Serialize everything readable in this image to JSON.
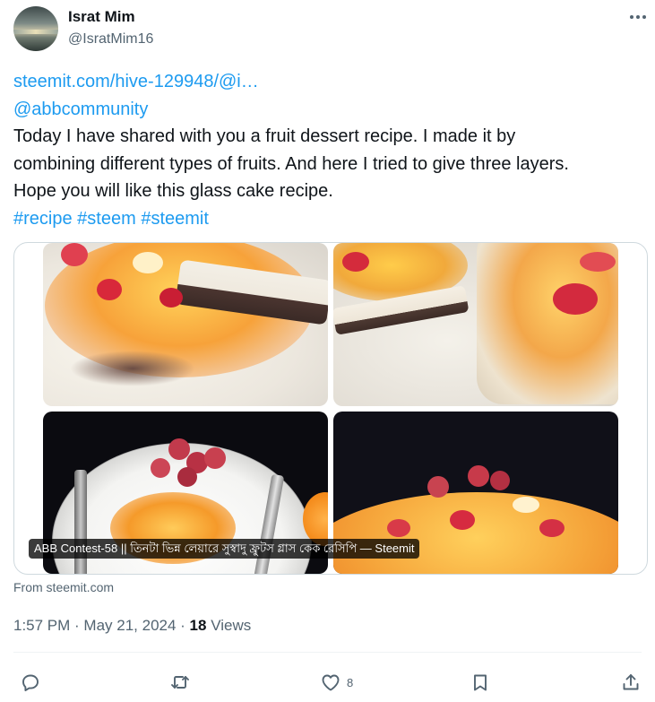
{
  "author": {
    "display_name": "Israt Mim",
    "handle": "@IsratMim16"
  },
  "post": {
    "link_text": "steemit.com/hive-129948/@i…",
    "mention": "@abbcommunity",
    "body_line1": "Today I have shared with you a fruit dessert recipe. I made it by",
    "body_line2": "combining different types of fruits. And here I tried to give three layers.",
    "body_line3": "Hope you will like this glass cake recipe.",
    "hashtags": [
      "#recipe",
      "#steem",
      "#steemit"
    ]
  },
  "card": {
    "title": "ABB Contest-58 || তিনটা ভিন্ন লেয়ারে সুস্বাদু ফ্রুটস গ্লাস কেক রেসিপি — Steemit",
    "source": "From steemit.com"
  },
  "meta": {
    "time": "1:57 PM",
    "separator": " · ",
    "date": "May 21, 2024",
    "views_count": "18",
    "views_label": " Views"
  },
  "actions": {
    "reply_icon": "reply-icon",
    "repost_icon": "repost-icon",
    "like_icon": "heart-icon",
    "like_count": "8",
    "bookmark_icon": "bookmark-icon",
    "share_icon": "share-icon"
  },
  "colors": {
    "accent": "#1d9bf0",
    "secondary_text": "#536471",
    "primary_text": "#0f1419"
  }
}
